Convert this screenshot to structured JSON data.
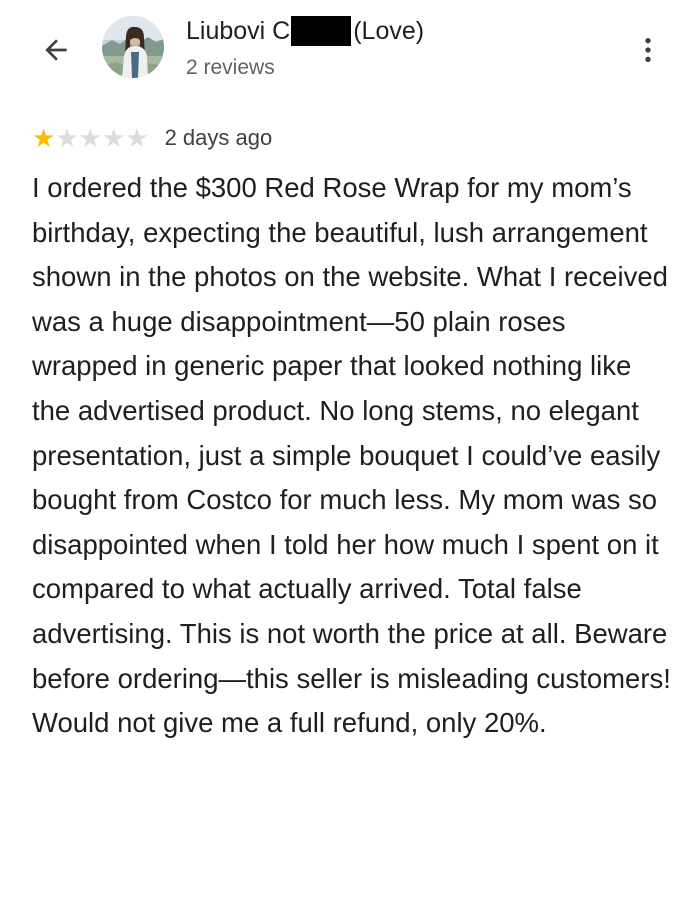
{
  "header": {
    "back_icon": "arrow-back-icon",
    "reviewer_first_name": "Liubovi C",
    "reviewer_nickname": "(Love)",
    "reviews_count": "2 reviews",
    "more_icon": "more-vert-icon"
  },
  "review": {
    "rating": 1,
    "max_rating": 5,
    "date": "2 days ago",
    "text": "I ordered the $300 Red Rose Wrap for my mom’s birthday, expecting the beautiful, lush arrangement shown in the photos on the website. What I received was a huge disappointment—50 plain roses wrapped in generic paper that looked nothing like the advertised product. No long stems, no elegant presentation, just a simple bouquet I could’ve easily bought from Costco for much less. My mom was so disappointed when I told her how much I spent on it compared to what actually arrived. Total false advertising. This is not worth the price at all. Beware before ordering—this seller is misleading customers! Would not give me a full refund, only 20%."
  },
  "colors": {
    "star_filled": "#fbbc04",
    "star_empty": "#dadce0",
    "secondary_text": "#5f6368"
  }
}
